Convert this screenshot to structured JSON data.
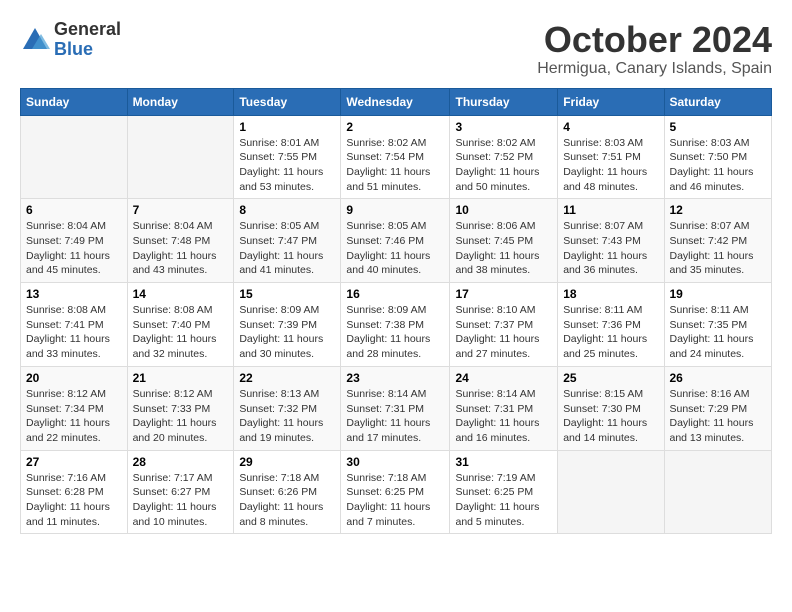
{
  "logo": {
    "general": "General",
    "blue": "Blue"
  },
  "title": "October 2024",
  "location": "Hermigua, Canary Islands, Spain",
  "days_header": [
    "Sunday",
    "Monday",
    "Tuesday",
    "Wednesday",
    "Thursday",
    "Friday",
    "Saturday"
  ],
  "weeks": [
    [
      {
        "num": "",
        "info": ""
      },
      {
        "num": "",
        "info": ""
      },
      {
        "num": "1",
        "info": "Sunrise: 8:01 AM\nSunset: 7:55 PM\nDaylight: 11 hours\nand 53 minutes."
      },
      {
        "num": "2",
        "info": "Sunrise: 8:02 AM\nSunset: 7:54 PM\nDaylight: 11 hours\nand 51 minutes."
      },
      {
        "num": "3",
        "info": "Sunrise: 8:02 AM\nSunset: 7:52 PM\nDaylight: 11 hours\nand 50 minutes."
      },
      {
        "num": "4",
        "info": "Sunrise: 8:03 AM\nSunset: 7:51 PM\nDaylight: 11 hours\nand 48 minutes."
      },
      {
        "num": "5",
        "info": "Sunrise: 8:03 AM\nSunset: 7:50 PM\nDaylight: 11 hours\nand 46 minutes."
      }
    ],
    [
      {
        "num": "6",
        "info": "Sunrise: 8:04 AM\nSunset: 7:49 PM\nDaylight: 11 hours\nand 45 minutes."
      },
      {
        "num": "7",
        "info": "Sunrise: 8:04 AM\nSunset: 7:48 PM\nDaylight: 11 hours\nand 43 minutes."
      },
      {
        "num": "8",
        "info": "Sunrise: 8:05 AM\nSunset: 7:47 PM\nDaylight: 11 hours\nand 41 minutes."
      },
      {
        "num": "9",
        "info": "Sunrise: 8:05 AM\nSunset: 7:46 PM\nDaylight: 11 hours\nand 40 minutes."
      },
      {
        "num": "10",
        "info": "Sunrise: 8:06 AM\nSunset: 7:45 PM\nDaylight: 11 hours\nand 38 minutes."
      },
      {
        "num": "11",
        "info": "Sunrise: 8:07 AM\nSunset: 7:43 PM\nDaylight: 11 hours\nand 36 minutes."
      },
      {
        "num": "12",
        "info": "Sunrise: 8:07 AM\nSunset: 7:42 PM\nDaylight: 11 hours\nand 35 minutes."
      }
    ],
    [
      {
        "num": "13",
        "info": "Sunrise: 8:08 AM\nSunset: 7:41 PM\nDaylight: 11 hours\nand 33 minutes."
      },
      {
        "num": "14",
        "info": "Sunrise: 8:08 AM\nSunset: 7:40 PM\nDaylight: 11 hours\nand 32 minutes."
      },
      {
        "num": "15",
        "info": "Sunrise: 8:09 AM\nSunset: 7:39 PM\nDaylight: 11 hours\nand 30 minutes."
      },
      {
        "num": "16",
        "info": "Sunrise: 8:09 AM\nSunset: 7:38 PM\nDaylight: 11 hours\nand 28 minutes."
      },
      {
        "num": "17",
        "info": "Sunrise: 8:10 AM\nSunset: 7:37 PM\nDaylight: 11 hours\nand 27 minutes."
      },
      {
        "num": "18",
        "info": "Sunrise: 8:11 AM\nSunset: 7:36 PM\nDaylight: 11 hours\nand 25 minutes."
      },
      {
        "num": "19",
        "info": "Sunrise: 8:11 AM\nSunset: 7:35 PM\nDaylight: 11 hours\nand 24 minutes."
      }
    ],
    [
      {
        "num": "20",
        "info": "Sunrise: 8:12 AM\nSunset: 7:34 PM\nDaylight: 11 hours\nand 22 minutes."
      },
      {
        "num": "21",
        "info": "Sunrise: 8:12 AM\nSunset: 7:33 PM\nDaylight: 11 hours\nand 20 minutes."
      },
      {
        "num": "22",
        "info": "Sunrise: 8:13 AM\nSunset: 7:32 PM\nDaylight: 11 hours\nand 19 minutes."
      },
      {
        "num": "23",
        "info": "Sunrise: 8:14 AM\nSunset: 7:31 PM\nDaylight: 11 hours\nand 17 minutes."
      },
      {
        "num": "24",
        "info": "Sunrise: 8:14 AM\nSunset: 7:31 PM\nDaylight: 11 hours\nand 16 minutes."
      },
      {
        "num": "25",
        "info": "Sunrise: 8:15 AM\nSunset: 7:30 PM\nDaylight: 11 hours\nand 14 minutes."
      },
      {
        "num": "26",
        "info": "Sunrise: 8:16 AM\nSunset: 7:29 PM\nDaylight: 11 hours\nand 13 minutes."
      }
    ],
    [
      {
        "num": "27",
        "info": "Sunrise: 7:16 AM\nSunset: 6:28 PM\nDaylight: 11 hours\nand 11 minutes."
      },
      {
        "num": "28",
        "info": "Sunrise: 7:17 AM\nSunset: 6:27 PM\nDaylight: 11 hours\nand 10 minutes."
      },
      {
        "num": "29",
        "info": "Sunrise: 7:18 AM\nSunset: 6:26 PM\nDaylight: 11 hours\nand 8 minutes."
      },
      {
        "num": "30",
        "info": "Sunrise: 7:18 AM\nSunset: 6:25 PM\nDaylight: 11 hours\nand 7 minutes."
      },
      {
        "num": "31",
        "info": "Sunrise: 7:19 AM\nSunset: 6:25 PM\nDaylight: 11 hours\nand 5 minutes."
      },
      {
        "num": "",
        "info": ""
      },
      {
        "num": "",
        "info": ""
      }
    ]
  ]
}
